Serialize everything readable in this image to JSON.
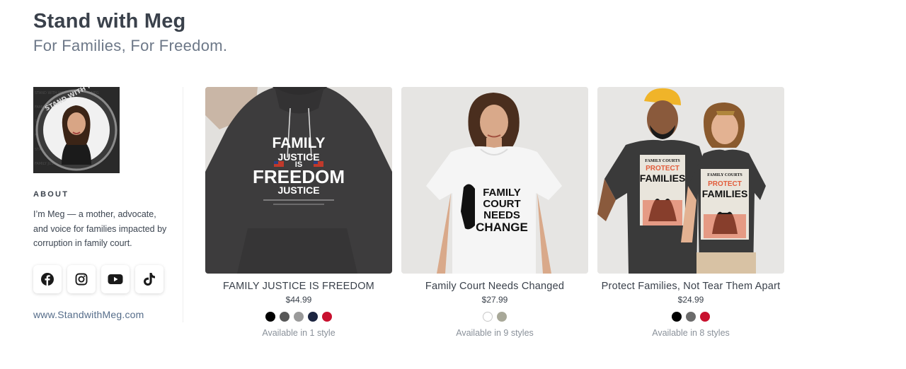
{
  "header": {
    "title": "Stand with Meg",
    "subtitle": "For Families, For Freedom."
  },
  "sidebar": {
    "avatar_text": "STAND WITH MEG",
    "about_heading": "ABOUT",
    "about_text": "I’m Meg — a mother, advocate, and voice for families impacted by corruption in family court.",
    "socials": [
      "facebook-icon",
      "instagram-icon",
      "youtube-icon",
      "tiktok-icon"
    ],
    "link": "www.StandwithMeg.com"
  },
  "products": [
    {
      "name": "FAMILY JUSTICE IS FREEDOM",
      "price": "$44.99",
      "availability": "Available in 1 style",
      "art": [
        "FAMILY",
        "JUSTICE",
        "IS",
        "FREEDOM",
        "JUSTICE"
      ],
      "swatches": [
        "#000000",
        "#585858",
        "#9a9a9a",
        "#1c2540",
        "#c8102e"
      ]
    },
    {
      "name": "Family Court Needs Changed",
      "price": "$27.99",
      "availability": "Available in 9 styles",
      "art": [
        "FAMILY",
        "COURT",
        "NEEDS",
        "CHANGE"
      ],
      "swatches": [
        "#ffffff",
        "#a8a898"
      ]
    },
    {
      "name": "Protect Families, Not Tear Them Apart",
      "price": "$24.99",
      "availability": "Available in 8 styles",
      "art": [
        "FAMILY COURTS",
        "PROTECT",
        "FAMILIES"
      ],
      "swatches": [
        "#000000",
        "#6b6b6b",
        "#c8102e"
      ]
    }
  ]
}
